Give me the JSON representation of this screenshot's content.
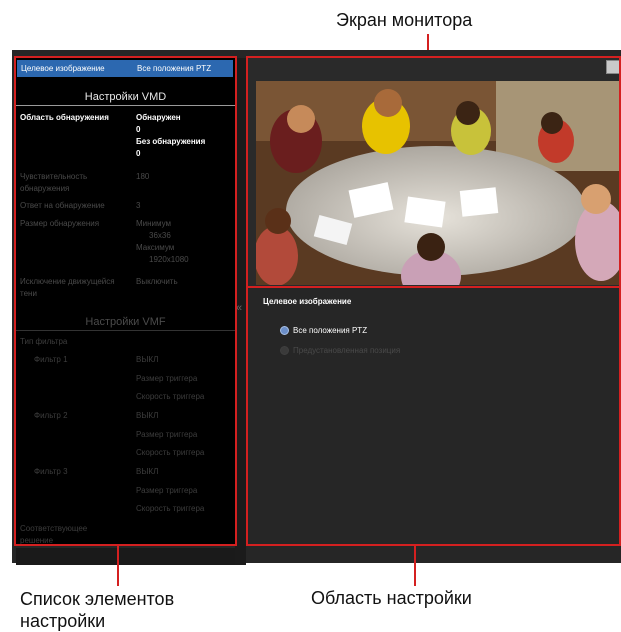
{
  "callouts": {
    "monitor_screen": "Экран монитора",
    "settings_list": "Список элементов\nнастройки",
    "setting_area": "Область настройки"
  },
  "top_row": {
    "label": "Целевое изображение",
    "value": "Все положения PTZ"
  },
  "vmd": {
    "title": "Настройки VMD",
    "detection_area": {
      "label": "Область обнаружения",
      "values": [
        "Обнаружен",
        "0",
        "Без обнаружения",
        "0"
      ]
    },
    "sensitivity": {
      "label": "Чувствительность обнаружения",
      "value": "180"
    },
    "response": {
      "label": "Ответ на обнаружение",
      "value": "3"
    },
    "size": {
      "label": "Размер обнаружения",
      "values": [
        "Минимум",
        "36x36",
        "Максимум",
        "1920x1080"
      ]
    },
    "shadow": {
      "label": "Исключение движущейся тени",
      "value": "Выключить"
    }
  },
  "vmf": {
    "title": "Настройки VMF",
    "filter_type_label": "Тип фильтра",
    "filters": [
      {
        "label": "Фильтр 1",
        "state": "ВЫКЛ",
        "opt1": "Размер триггера",
        "opt2": "Скорость триггера"
      },
      {
        "label": "Фильтр 2",
        "state": "ВЫКЛ",
        "opt1": "Размер триггера",
        "opt2": "Скорость триггера"
      },
      {
        "label": "Фильтр 3",
        "state": "ВЫКЛ",
        "opt1": "Размер триггера",
        "opt2": "Скорость триггера"
      }
    ],
    "matching_label": "Соответствующее решение"
  },
  "setting_area": {
    "title": "Целевое изображение",
    "options": [
      {
        "label": "Все положения PTZ",
        "selected": true
      },
      {
        "label": "Предустановленная позиция",
        "selected": false
      }
    ]
  },
  "colors": {
    "accent_red": "#d42020",
    "selected_blue": "#2c68b0"
  },
  "icons": {
    "collapse": "double-chevron-left-icon",
    "fullscreen": "fullscreen-icon"
  }
}
